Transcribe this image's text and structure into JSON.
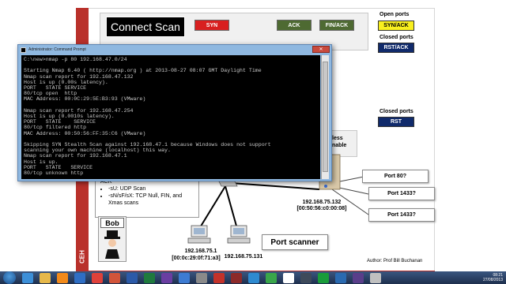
{
  "slide": {
    "title": "Connect Scan",
    "tags": {
      "syn": "SYN",
      "ack": "ACK",
      "finack": "FIN/ACK"
    },
    "open_ports_label": "Open ports",
    "open_ports_value": "SYN/ACK",
    "closed_ports_label_1": "Closed ports",
    "closed_ports_value_1": "RST/ACK",
    "closed_ports_label_2": "Closed ports",
    "closed_ports_value_2": "RST",
    "mid_text_1": "less",
    "mid_text_2": "nable",
    "ports": {
      "p80": "Port 80?",
      "p1433a": "Port 1433?",
      "p1433b": "Port 1433?"
    },
    "scanner": "Port scanner",
    "server_ip": "192.168.75.132",
    "server_mac": "[00:50:56:c0:00:08]",
    "host1_ip": "192.168.75.1",
    "host1_mac": "[00:0c:29:0f:71:a3]",
    "host2_ip": "192.168.75.131",
    "author": "Author: Prof Bill Buchanan",
    "rail_label": "CEH",
    "bob": "Bob",
    "notes": {
      "first": "ACK",
      "items": [
        "-sU: UDP Scan",
        "-sN/sF/sX: TCP Null, FIN, and Xmas scans"
      ]
    }
  },
  "cmd": {
    "title": "Administrator: Command Prompt",
    "close": "✕",
    "lines": [
      "C:\\new>nmap -p 80 192.168.47.0/24",
      "",
      "Starting Nmap 6.40 ( http://nmap.org ) at 2013-08-27 08:07 GMT Daylight Time",
      "Nmap scan report for 192.168.47.132",
      "Host is up (0.00s latency).",
      "PORT   STATE SERVICE",
      "80/tcp open  http",
      "MAC Address: 00:0C:29:5E:B3:93 (VMware)",
      "",
      "Nmap scan report for 192.168.47.254",
      "Host is up (0.0010s latency).",
      "PORT   STATE    SERVICE",
      "80/tcp filtered http",
      "MAC Address: 00:50:56:FF:35:C6 (VMware)",
      "",
      "Skipping SYN Stealth Scan against 192.168.47.1 because Windows does not support",
      "scanning your own machine (localhost) this way.",
      "Nmap scan report for 192.168.47.1",
      "Host is up.",
      "PORT   STATE   SERVICE",
      "80/tcp unknown http",
      "",
      "Nmap done: 256 IP addresses (3 hosts up) scanned in 13.95 seconds",
      "",
      "C:\\new>nmap -p 80 192_"
    ]
  },
  "taskbar": {
    "time": "08:21",
    "date": "27/08/2013",
    "icons": [
      {
        "name": "ie-icon",
        "color": "#3c8fd8"
      },
      {
        "name": "explorer-icon",
        "color": "#e6b84a"
      },
      {
        "name": "media-player-icon",
        "color": "#f28a1a"
      },
      {
        "name": "outlook-icon",
        "color": "#2f6ec4"
      },
      {
        "name": "chrome-icon",
        "color": "#e0413a"
      },
      {
        "name": "powerpoint-icon",
        "color": "#d2543a"
      },
      {
        "name": "word-icon",
        "color": "#2b5aa8"
      },
      {
        "name": "excel-icon",
        "color": "#1f7a3d"
      },
      {
        "name": "visual-studio-icon",
        "color": "#6a3ea1"
      },
      {
        "name": "app-icon-10",
        "color": "#3d7bd2"
      },
      {
        "name": "app-icon-11",
        "color": "#8a8a8a"
      },
      {
        "name": "filezilla-icon",
        "color": "#c4322a"
      },
      {
        "name": "app-icon-13",
        "color": "#8c2a2a"
      },
      {
        "name": "app-icon-14",
        "color": "#2e8ad0"
      },
      {
        "name": "app-icon-15",
        "color": "#3aa64a"
      },
      {
        "name": "app-icon-16",
        "color": "#ffffff"
      },
      {
        "name": "app-icon-17",
        "color": "#3e4a5a"
      },
      {
        "name": "app-icon-18",
        "color": "#1a9c3a"
      },
      {
        "name": "app-icon-19",
        "color": "#2a6ab0"
      },
      {
        "name": "app-icon-20",
        "color": "#5a3e8a"
      },
      {
        "name": "app-icon-21",
        "color": "#c0c0c0"
      }
    ]
  }
}
